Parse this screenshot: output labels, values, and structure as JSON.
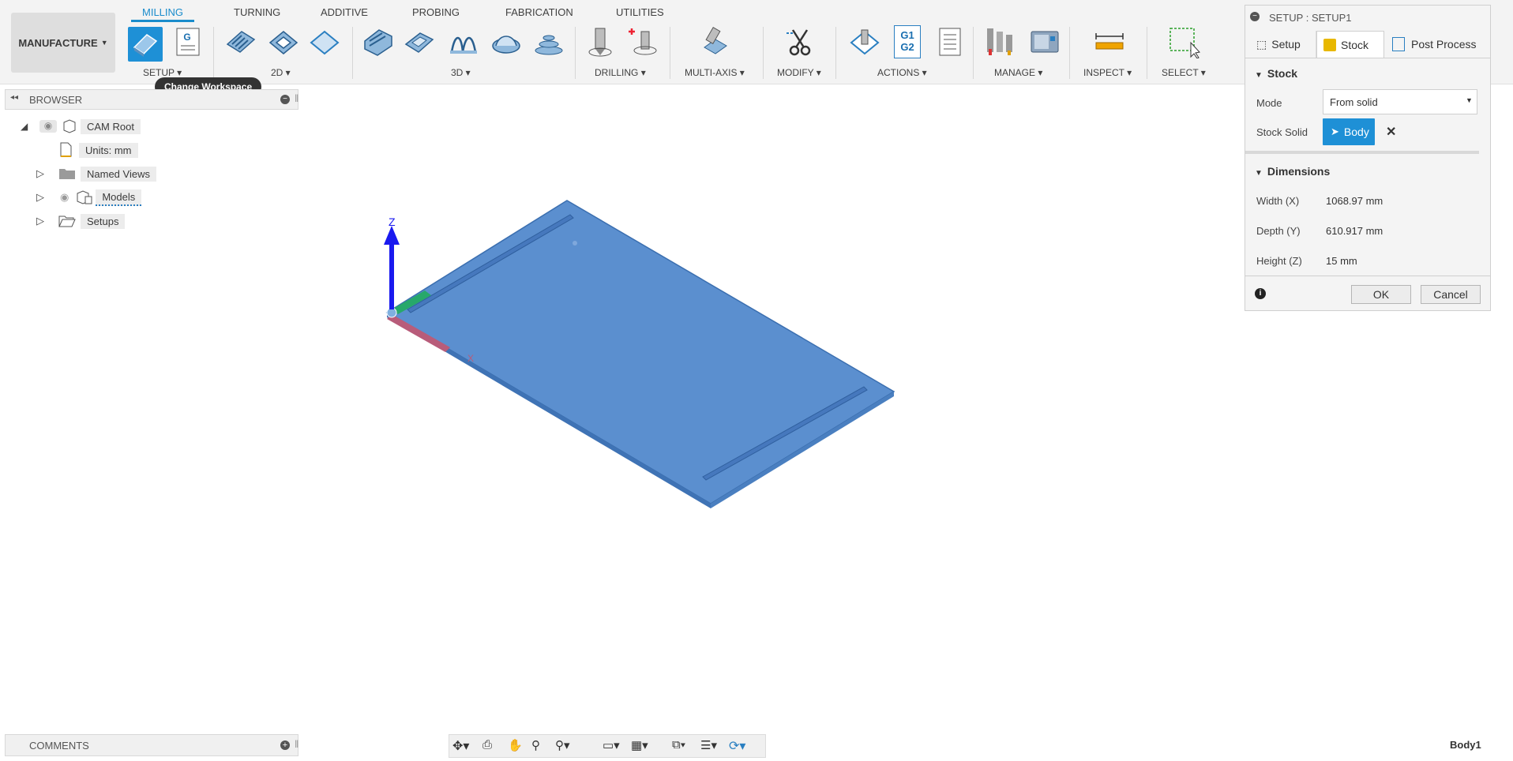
{
  "workspace": {
    "label": "MANUFACTURE",
    "tooltip": "Change Workspace"
  },
  "tabs": [
    {
      "label": "MILLING",
      "active": true
    },
    {
      "label": "TURNING"
    },
    {
      "label": "ADDITIVE"
    },
    {
      "label": "PROBING"
    },
    {
      "label": "FABRICATION"
    },
    {
      "label": "UTILITIES"
    }
  ],
  "groups": {
    "setup": "SETUP",
    "g2d": "2D",
    "g3d": "3D",
    "drilling": "DRILLING",
    "multiaxis": "MULTI-AXIS",
    "modify": "MODIFY",
    "actions": "ACTIONS",
    "manage": "MANAGE",
    "inspect": "INSPECT",
    "select": "SELECT"
  },
  "icons": {
    "g_code": "G",
    "g1": "G1",
    "g2": "G2"
  },
  "browser": {
    "title": "BROWSER",
    "items": [
      {
        "label": "CAM Root"
      },
      {
        "label": "Units: mm"
      },
      {
        "label": "Named Views"
      },
      {
        "label": "Models"
      },
      {
        "label": "Setups"
      }
    ]
  },
  "viewport": {
    "z_axis": "Z",
    "x_axis": "X",
    "body_color": "#5b8fcf"
  },
  "comments": {
    "title": "COMMENTS"
  },
  "status": {
    "selection": "Body1"
  },
  "panel": {
    "title": "SETUP : SETUP1",
    "tabs": [
      {
        "label": "Setup"
      },
      {
        "label": "Stock",
        "active": true
      },
      {
        "label": "Post Process"
      }
    ],
    "stock": {
      "heading": "Stock",
      "mode_label": "Mode",
      "mode_value": "From solid",
      "solid_label": "Stock Solid",
      "solid_value": "Body"
    },
    "dimensions": {
      "heading": "Dimensions",
      "width_label": "Width (X)",
      "width_value": "1068.97 mm",
      "depth_label": "Depth (Y)",
      "depth_value": "610.917 mm",
      "height_label": "Height (Z)",
      "height_value": "15 mm"
    },
    "ok": "OK",
    "cancel": "Cancel"
  },
  "colors": {
    "accent": "#1a8ccc",
    "selection": "#1e90d6"
  }
}
